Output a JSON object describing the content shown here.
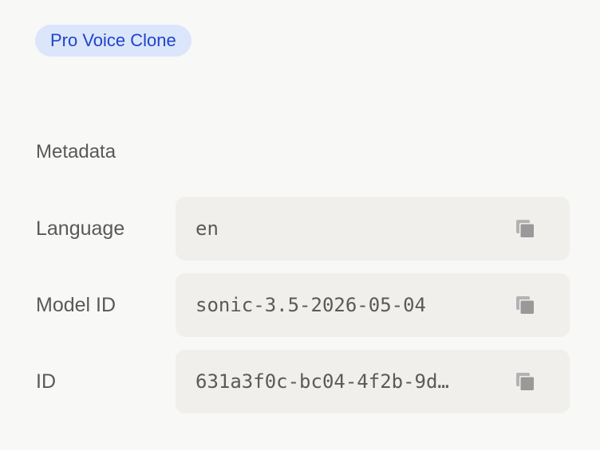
{
  "badge": {
    "label": "Pro Voice Clone",
    "bg": "#dbe6fb",
    "fg": "#1f44c9"
  },
  "metadata": {
    "title": "Metadata",
    "rows": [
      {
        "label": "Language",
        "value": "en",
        "icon": "copy-icon"
      },
      {
        "label": "Model ID",
        "value": "sonic-3.5-2026-05-04",
        "icon": "copy-icon"
      },
      {
        "label": "ID",
        "value": "631a3f0c-bc04-4f2b-9d…",
        "icon": "copy-icon"
      }
    ]
  }
}
